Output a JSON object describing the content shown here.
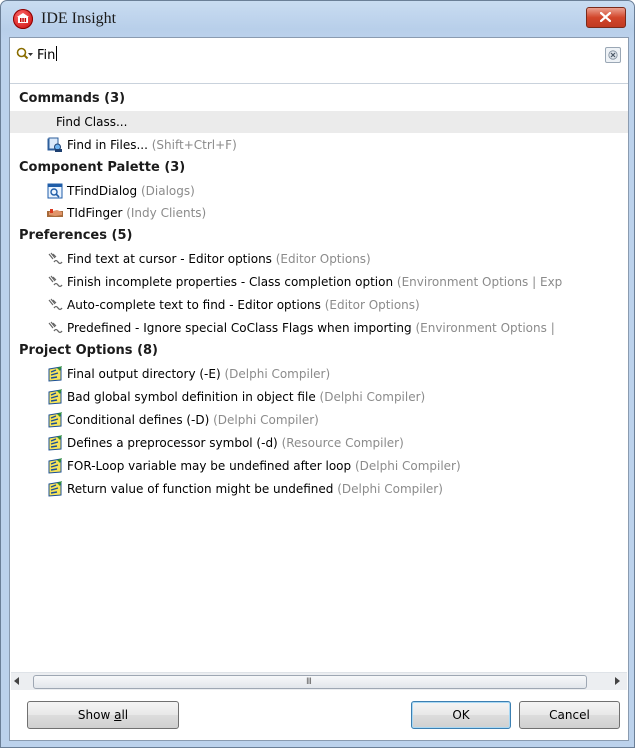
{
  "window": {
    "title": "IDE Insight"
  },
  "search": {
    "value": "Fin"
  },
  "groups": [
    {
      "title": "Commands (3)",
      "items": [
        {
          "label": "Find Class...",
          "hint": "",
          "icon": "none"
        },
        {
          "label": "Find in Files...",
          "hint": " (Shift+Ctrl+F)",
          "icon": "find-in-files-icon"
        }
      ]
    },
    {
      "title": "Component Palette (3)",
      "items": [
        {
          "label": "TFindDialog",
          "hint": " (Dialogs)",
          "icon": "find-dialog-component-icon"
        },
        {
          "label": "TIdFinger",
          "hint": " (Indy Clients)",
          "icon": "finger-component-icon"
        }
      ]
    },
    {
      "title": "Preferences (5)",
      "items": [
        {
          "label": "Find text at cursor - Editor options",
          "hint": " (Editor Options)",
          "icon": "preferences-icon"
        },
        {
          "label": "Finish incomplete properties - Class completion option",
          "hint": " (Environment Options | Exp",
          "icon": "preferences-icon"
        },
        {
          "label": "Auto-complete text to find - Editor options",
          "hint": " (Editor Options)",
          "icon": "preferences-icon"
        },
        {
          "label": "Predefined - Ignore special CoClass Flags when importing",
          "hint": " (Environment Options |",
          "icon": "preferences-icon"
        }
      ]
    },
    {
      "title": "Project Options (8)",
      "items": [
        {
          "label": "Final output directory (-E)",
          "hint": " (Delphi Compiler)",
          "icon": "project-options-icon"
        },
        {
          "label": "Bad global symbol definition in object file",
          "hint": " (Delphi Compiler)",
          "icon": "project-options-icon"
        },
        {
          "label": "Conditional defines (-D)",
          "hint": " (Delphi Compiler)",
          "icon": "project-options-icon"
        },
        {
          "label": "Defines a preprocessor symbol (-d)",
          "hint": " (Resource Compiler)",
          "icon": "project-options-icon"
        },
        {
          "label": "FOR-Loop variable may be undefined after loop",
          "hint": " (Delphi Compiler)",
          "icon": "project-options-icon"
        },
        {
          "label": "Return value of function might be undefined",
          "hint": " (Delphi Compiler)",
          "icon": "project-options-icon"
        }
      ]
    }
  ],
  "scrollbar": {
    "grip": "III"
  },
  "buttons": {
    "show_all_prefix": "Show ",
    "show_all_underlined": "a",
    "show_all_suffix": "ll",
    "ok": "OK",
    "cancel": "Cancel"
  },
  "colors": {
    "hint_text": "#8b8b8b",
    "selected_row": "#ebebeb",
    "title_bar": "#c9dcf1"
  }
}
